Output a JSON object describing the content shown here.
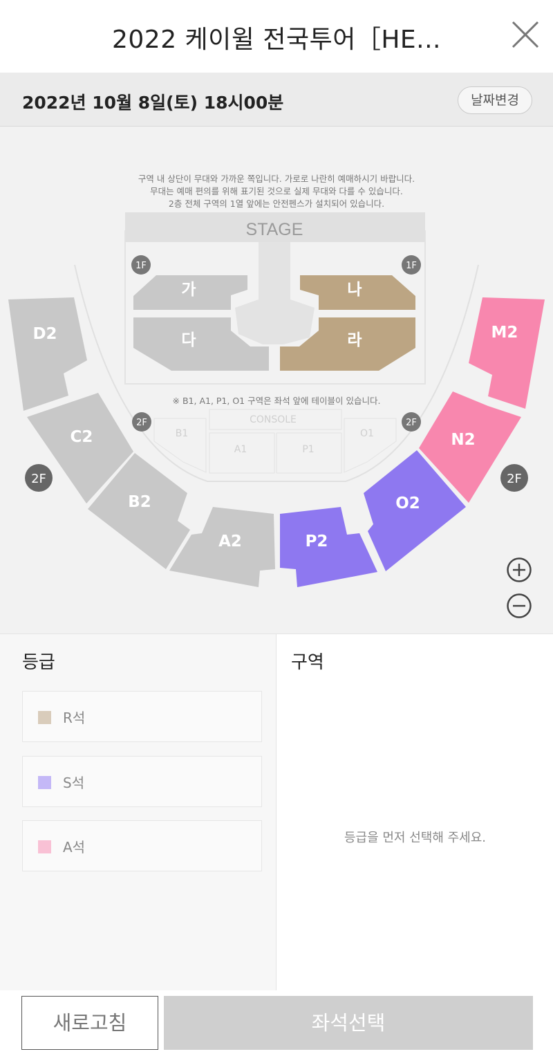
{
  "header": {
    "title": "2022 케이윌 전국투어［HE...",
    "close_icon": "close-icon"
  },
  "date_bar": {
    "date": "2022년 10월 8일(토) 18시00분",
    "change_label": "날짜변경"
  },
  "seat_map": {
    "notice": [
      "구역 내 상단이 무대와  가까운 쪽입니다. 가로로 나란히 예매하시기 바랍니다.",
      "무대는 예매 편의를 위해 표기된 것으로 실제 무대와 다를 수 있습니다.",
      "2층 전체 구역의 1열 앞에는 안전펜스가 설치되어 있습니다."
    ],
    "stage": "STAGE",
    "table_notice": "※ B1, A1, P1, O1 구역은 좌석 앞에 테이블이 있습니다.",
    "console": "CONSOLE",
    "floor_1f": "1F",
    "floor_2f": "2F",
    "floor1_sections": [
      "가",
      "나",
      "다",
      "라"
    ],
    "floor1_lower": [
      "B1",
      "A1",
      "P1",
      "O1"
    ],
    "floor2_sections": [
      "D2",
      "C2",
      "B2",
      "A2",
      "P2",
      "O2",
      "N2",
      "M2"
    ],
    "colors": {
      "unavailable": "#c8c8c8",
      "R": "#bca583",
      "S": "#8e78f0",
      "A": "#f887ae"
    },
    "zoom_in_icon": "plus-circle-icon",
    "zoom_out_icon": "minus-circle-icon"
  },
  "grade_panel": {
    "heading": "등급",
    "grades": [
      {
        "label": "R석",
        "color": "#d9ccbb"
      },
      {
        "label": "S석",
        "color": "#c4b8f7"
      },
      {
        "label": "A석",
        "color": "#f9c1d5"
      }
    ]
  },
  "zone_panel": {
    "heading": "구역",
    "empty_message": "등급을 먼저 선택해 주세요."
  },
  "actions": {
    "refresh_label": "새로고침",
    "select_label": "좌석선택"
  }
}
